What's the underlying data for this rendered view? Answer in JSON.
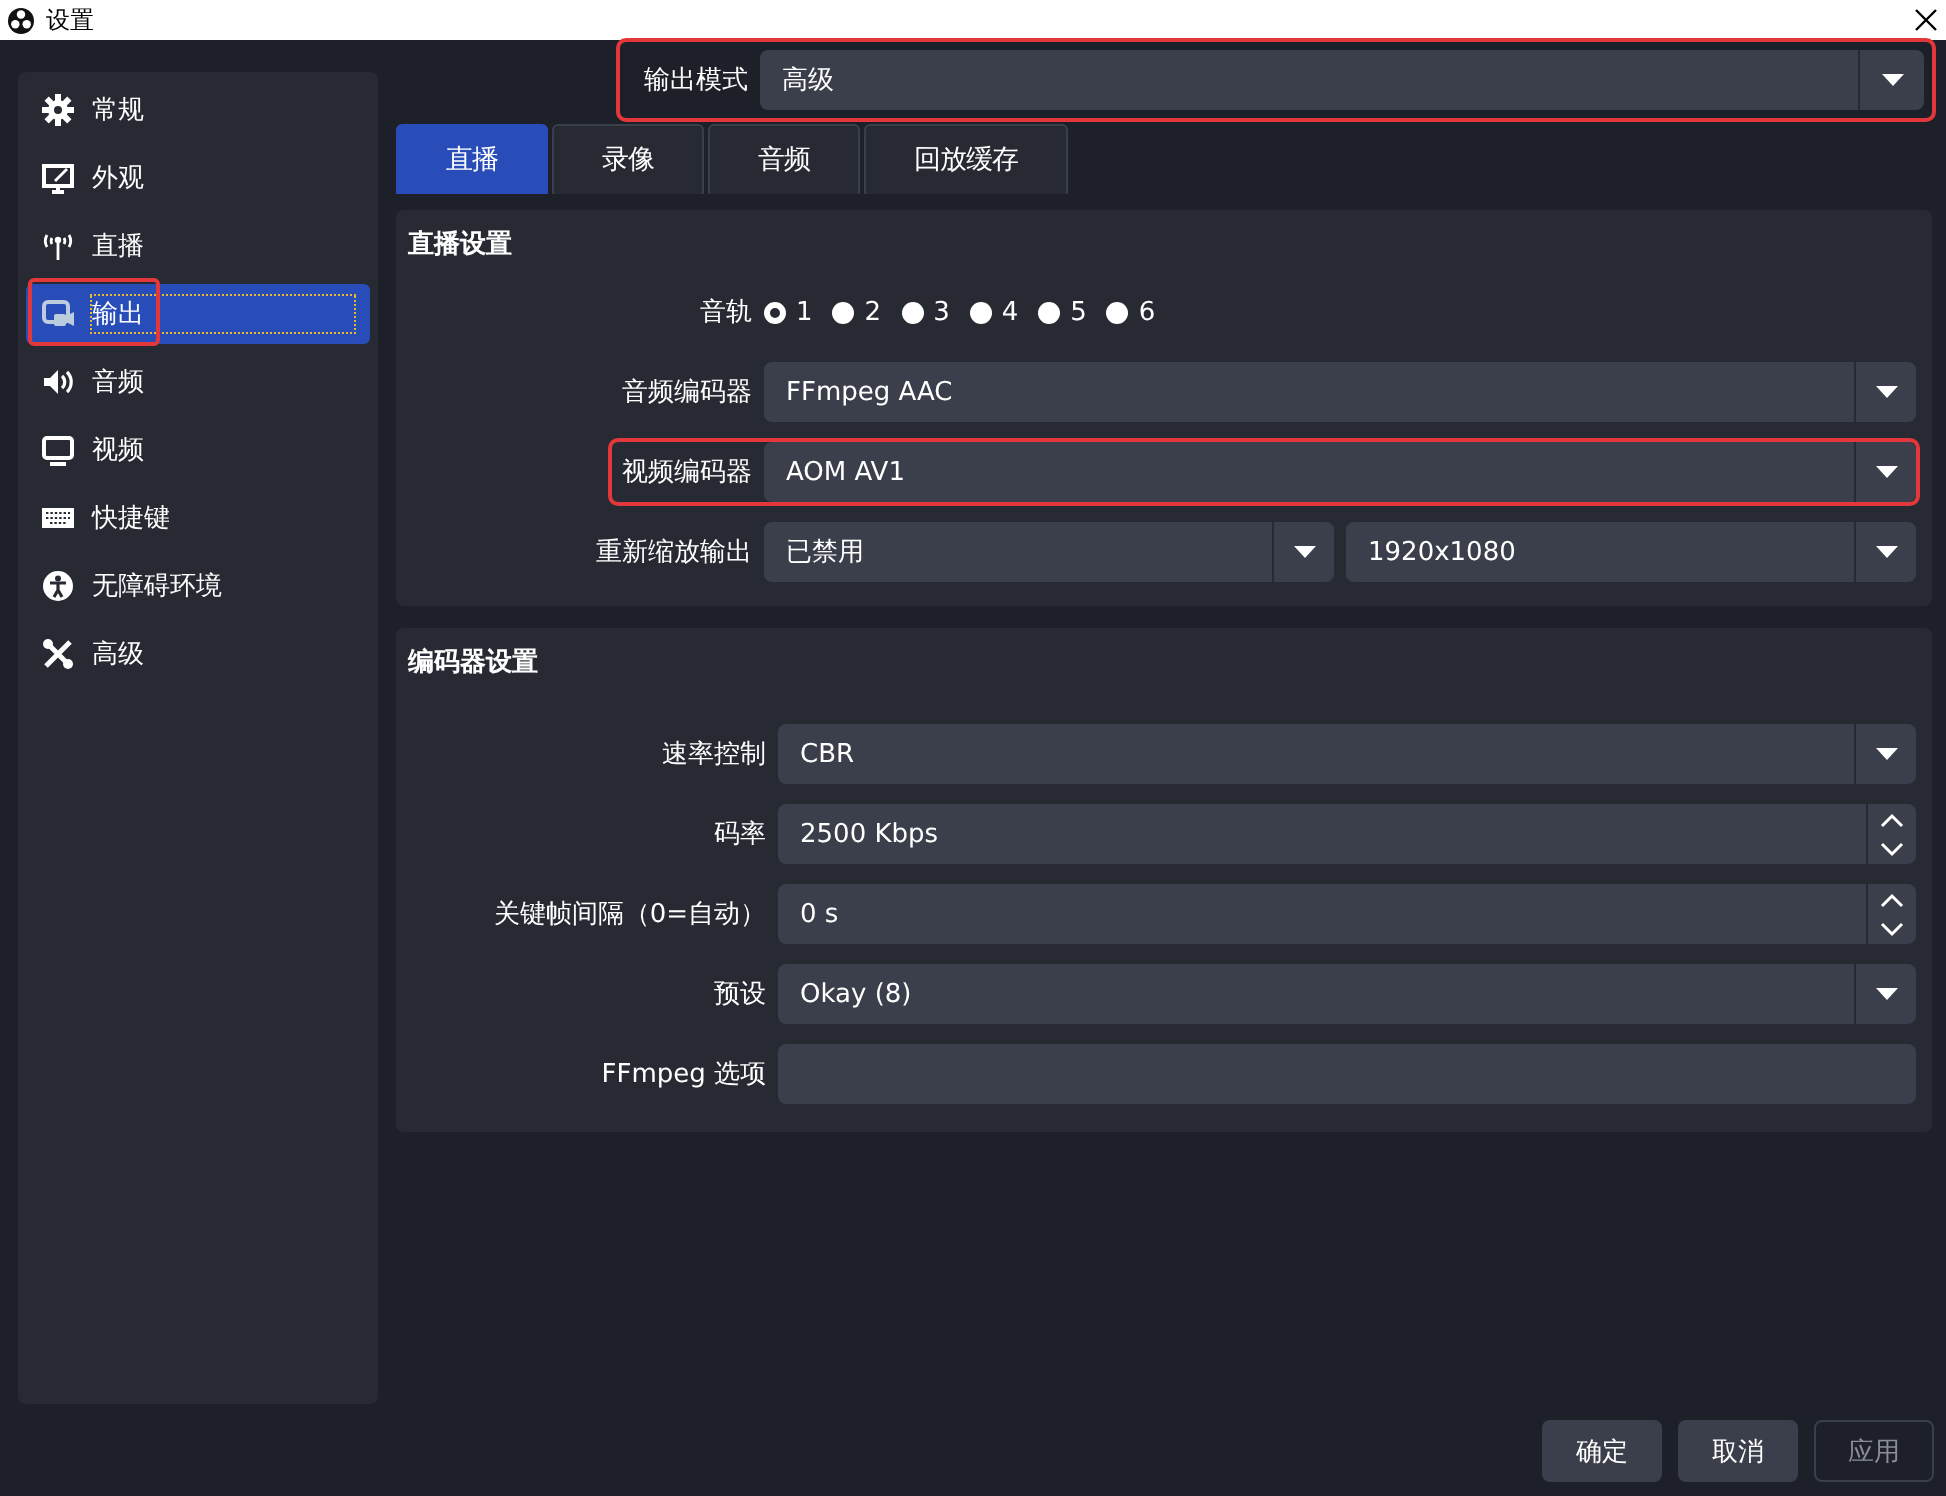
{
  "window": {
    "title": "设置"
  },
  "sidebar": {
    "items": [
      {
        "label": "常规",
        "selected": false,
        "highlighted": false
      },
      {
        "label": "外观",
        "selected": false,
        "highlighted": false
      },
      {
        "label": "直播",
        "selected": false,
        "highlighted": false
      },
      {
        "label": "输出",
        "selected": true,
        "highlighted": true
      },
      {
        "label": "音频",
        "selected": false,
        "highlighted": false
      },
      {
        "label": "视频",
        "selected": false,
        "highlighted": false
      },
      {
        "label": "快捷键",
        "selected": false,
        "highlighted": false
      },
      {
        "label": "无障碍环境",
        "selected": false,
        "highlighted": false
      },
      {
        "label": "高级",
        "selected": false,
        "highlighted": false
      }
    ]
  },
  "output_mode": {
    "label": "输出模式",
    "value": "高级",
    "highlighted": true
  },
  "tabs": [
    {
      "label": "直播",
      "selected": true
    },
    {
      "label": "录像",
      "selected": false
    },
    {
      "label": "音频",
      "selected": false
    },
    {
      "label": "回放缓存",
      "selected": false
    }
  ],
  "stream_settings": {
    "title": "直播设置",
    "rows": [
      {
        "kind": "radios",
        "label": "音轨",
        "options": [
          {
            "label": "1",
            "selected": true
          },
          {
            "label": "2",
            "selected": false
          },
          {
            "label": "3",
            "selected": false
          },
          {
            "label": "4",
            "selected": false
          },
          {
            "label": "5",
            "selected": false
          },
          {
            "label": "6",
            "selected": false
          }
        ]
      },
      {
        "kind": "dropdown",
        "label": "音频编码器",
        "value": "FFmpeg AAC",
        "highlighted": false
      },
      {
        "kind": "dropdown",
        "label": "视频编码器",
        "value": "AOM AV1",
        "highlighted": true
      },
      {
        "kind": "pair",
        "label": "重新缩放输出",
        "values": [
          "已禁用",
          "1920x1080"
        ]
      }
    ]
  },
  "encoder_settings": {
    "title": "编码器设置",
    "rows": [
      {
        "kind": "dropdown",
        "label": "速率控制",
        "value": "CBR"
      },
      {
        "kind": "spin",
        "label": "码率",
        "value": "2500 Kbps"
      },
      {
        "kind": "spin",
        "label": "关键帧间隔（0=自动）",
        "value": "0 s"
      },
      {
        "kind": "dropdown",
        "label": "预设",
        "value": "Okay (8)"
      },
      {
        "kind": "text",
        "label": "FFmpeg 选项"
      }
    ]
  },
  "buttons": [
    {
      "label": "确定",
      "disabled": false
    },
    {
      "label": "取消",
      "disabled": false
    },
    {
      "label": "应用",
      "disabled": true
    }
  ]
}
